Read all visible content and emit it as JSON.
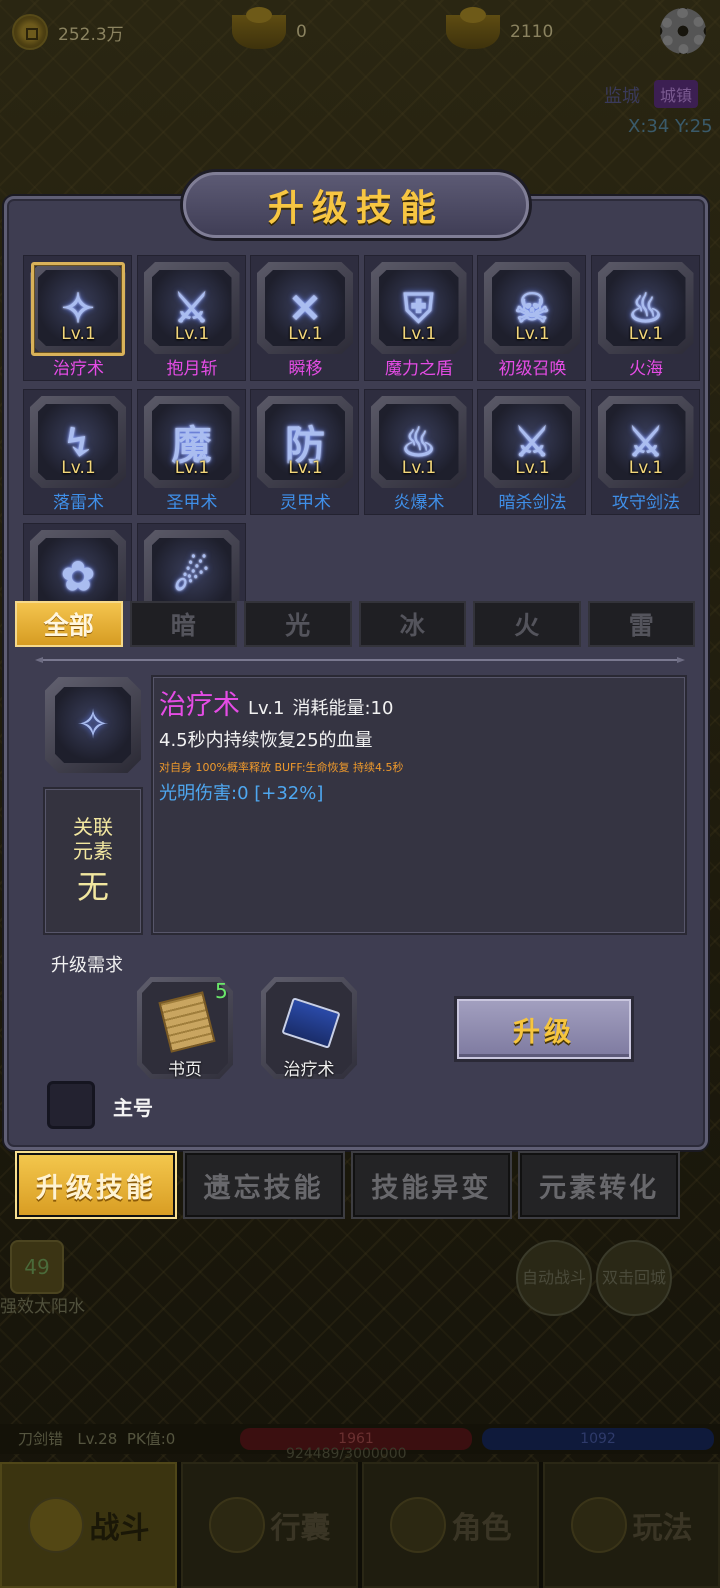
{
  "resources": {
    "copper": "252.3万",
    "gold": "0",
    "silver": "2110"
  },
  "location": {
    "name": "监城",
    "badge": "城镇",
    "coords": "X:34 Y:25"
  },
  "dialog": {
    "title": "升级技能",
    "skills": [
      {
        "name": "治疗术",
        "level": "Lv.1",
        "glyph": "✧",
        "color": "#e54ce5",
        "selected": true
      },
      {
        "name": "抱月斩",
        "level": "Lv.1",
        "glyph": "⚔",
        "color": "#e54ce5"
      },
      {
        "name": "瞬移",
        "level": "Lv.1",
        "glyph": "✕",
        "color": "#e54ce5"
      },
      {
        "name": "魔力之盾",
        "level": "Lv.1",
        "glyph": "⛨",
        "color": "#e54ce5"
      },
      {
        "name": "初级召唤",
        "level": "Lv.1",
        "glyph": "☠",
        "color": "#e54ce5"
      },
      {
        "name": "火海",
        "level": "Lv.1",
        "glyph": "♨",
        "color": "#e54ce5"
      },
      {
        "name": "落雷术",
        "level": "Lv.1",
        "glyph": "↯",
        "color": "#3f8fe8"
      },
      {
        "name": "圣甲术",
        "level": "Lv.1",
        "glyph": "魔",
        "color": "#3f8fe8"
      },
      {
        "name": "灵甲术",
        "level": "Lv.1",
        "glyph": "防",
        "color": "#3f8fe8"
      },
      {
        "name": "炎爆术",
        "level": "Lv.1",
        "glyph": "♨",
        "color": "#3f8fe8"
      },
      {
        "name": "暗杀剑法",
        "level": "Lv.1",
        "glyph": "⚔",
        "color": "#3f8fe8"
      },
      {
        "name": "攻守剑法",
        "level": "Lv.1",
        "glyph": "⚔",
        "color": "#3f8fe8"
      },
      {
        "name": "",
        "level": "",
        "glyph": "✿",
        "color": "#3f8fe8"
      },
      {
        "name": "",
        "level": "",
        "glyph": "☄",
        "color": "#3f8fe8"
      }
    ],
    "tabs": [
      "全部",
      "暗",
      "光",
      "冰",
      "火",
      "雷"
    ],
    "active_tab": 0,
    "detail": {
      "icon_glyph": "✧",
      "element_label": "关联元素",
      "element_value": "无",
      "name": "治疗术",
      "level": "Lv.1",
      "cost": "消耗能量:10",
      "effect": "4.5秒内持续恢复25的血量",
      "buff": "对自身 100%概率释放 BUFF:生命恢复 持续4.5秒",
      "damage": "光明伤害:0 [+32%]"
    },
    "requirements": {
      "label": "升级需求",
      "items": [
        {
          "name": "书页",
          "count": "5"
        },
        {
          "name": "治疗术",
          "count": ""
        }
      ]
    },
    "upgrade_button": "升级",
    "main_account_label": "主号"
  },
  "function_tabs": [
    "升级技能",
    "遗忘技能",
    "技能异变",
    "元素转化"
  ],
  "active_function_tab": 0,
  "hud": {
    "level_badge": "49",
    "item_label": "强效太阳水",
    "auto_battle": "自动战斗",
    "double_click": "双击回城",
    "player_name": "刀剑错",
    "player_level": "Lv.28",
    "pk": "PK值:0",
    "hp": "1961",
    "mp": "1092",
    "exp": "924489/3000000"
  },
  "bottom_nav": [
    "战斗",
    "行囊",
    "角色",
    "玩法"
  ]
}
